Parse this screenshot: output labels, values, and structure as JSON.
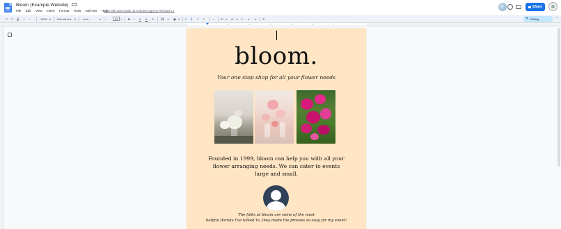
{
  "window": {
    "doc_title": "Bloom (Example Website)",
    "last_edit": "Last edit was made 11 minutes ago by Richard Le"
  },
  "menu": [
    "File",
    "Edit",
    "View",
    "Insert",
    "Format",
    "Tools",
    "Add-ons",
    "Help"
  ],
  "header": {
    "share_label": "Share"
  },
  "toolbar": {
    "zoom": "100%",
    "style": "Normal text",
    "font": "Lora",
    "font_size": "20",
    "decrease_size": "−",
    "increase_size": "+",
    "bold": "B",
    "italic": "I",
    "underline": "U",
    "text_color": "A",
    "mode": "Editing"
  },
  "ruler": {
    "ticks": [
      "1",
      "1",
      "2",
      "3",
      "4",
      "5",
      "6",
      "7"
    ]
  },
  "document": {
    "title": "bloom.",
    "tagline": "Your one stop shop for all your flower needs",
    "description": "Founded in 1999, bloom can help you with all your flower arranging needs. We can cater to events large and small.",
    "testimonial_line1": "The folks at bloom are some of the most",
    "testimonial_line2": "helpful florists I've talked to, they made the process so easy for my event!"
  },
  "colors": {
    "page_background": "#ffe5c3",
    "share_button": "#1a73e8",
    "toolbar_background": "#edf2fa",
    "editing_chip": "#c2e7ff",
    "avatar_background": "#2f4257"
  },
  "icons": [
    "docs-logo-icon",
    "star-icon",
    "cloud-status-icon",
    "history-icon",
    "chat-icon",
    "lock-icon",
    "undo-icon",
    "redo-icon",
    "print-icon",
    "spellcheck-icon",
    "paint-format-icon",
    "link-icon",
    "comment-icon",
    "image-icon",
    "align-left-icon",
    "align-center-icon",
    "align-right-icon",
    "justify-icon",
    "line-spacing-icon",
    "checklist-icon",
    "bullet-list-icon",
    "numbered-list-icon",
    "indent-decrease-icon",
    "indent-increase-icon",
    "clear-formatting-icon",
    "pencil-icon",
    "outline-icon"
  ]
}
